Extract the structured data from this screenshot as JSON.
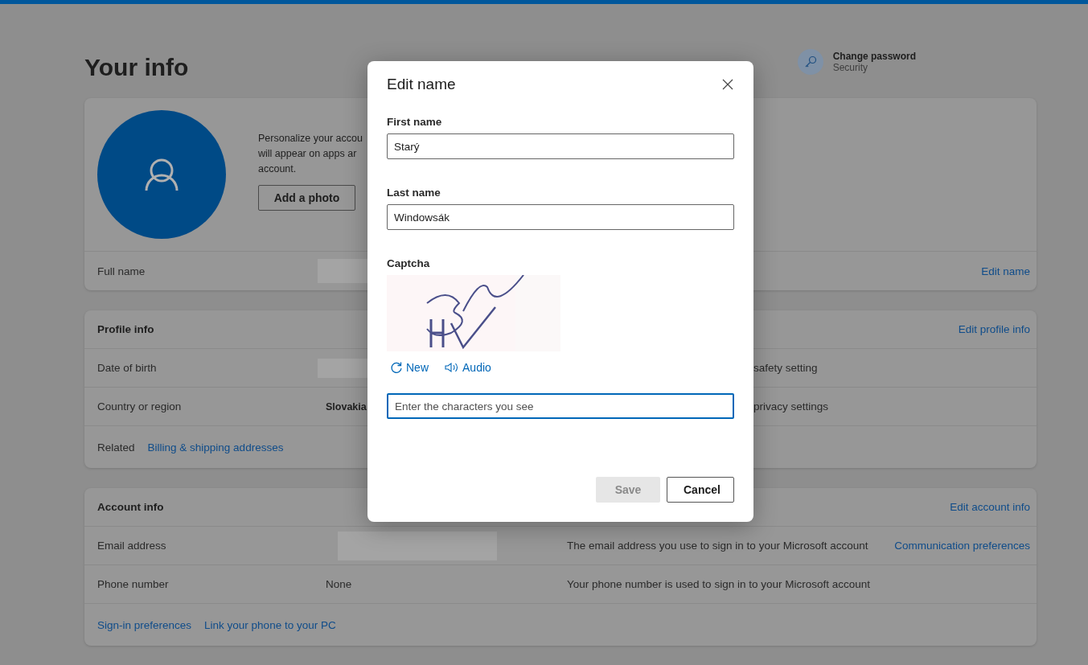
{
  "page": {
    "title": "Your info",
    "security_link": {
      "title": "Change password",
      "subtitle": "Security"
    }
  },
  "profile_card": {
    "description_lines": [
      "Personalize your accou",
      "will appear on apps ar",
      "account."
    ],
    "add_photo": "Add a photo",
    "full_name_label": "Full name",
    "edit_link": "Edit name"
  },
  "profile_info": {
    "title": "Profile info",
    "edit_link": "Edit profile info",
    "rows": [
      {
        "label": "Date of birth",
        "value_redacted": true,
        "note": "safety setting"
      },
      {
        "label": "Country or region",
        "value": "Slovakia",
        "note": "privacy settings"
      }
    ],
    "related": {
      "label": "Related",
      "links": [
        "Billing & shipping addresses"
      ]
    }
  },
  "account_info": {
    "title": "Account info",
    "edit_link": "Edit account info",
    "rows": [
      {
        "label": "Email address",
        "value_redacted": true,
        "note": "The email address you use to sign in to your Microsoft account",
        "link": "Communication preferences"
      },
      {
        "label": "Phone number",
        "value": "None",
        "note": "Your phone number is used to sign in to your Microsoft account"
      }
    ],
    "links": [
      "Sign-in preferences",
      "Link your phone to your PC"
    ]
  },
  "dialog": {
    "title": "Edit name",
    "fields": [
      {
        "label": "First name",
        "value": "Starý"
      },
      {
        "label": "Last name",
        "value": "Windowsák"
      }
    ],
    "captcha": {
      "label": "Captcha",
      "new_link": "New",
      "audio_link": "Audio",
      "input": {
        "placeholder": "Enter the characters you see",
        "focused": true
      }
    },
    "buttons": [
      {
        "label": "Save",
        "disabled": true
      },
      {
        "label": "Cancel",
        "disabled": false
      }
    ]
  }
}
